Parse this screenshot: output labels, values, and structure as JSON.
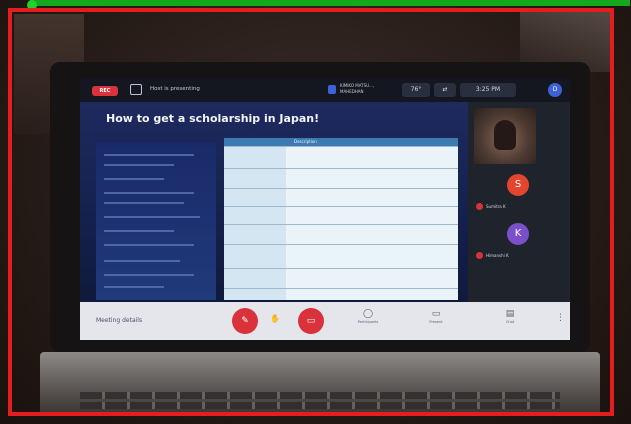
{
  "topbar": {
    "rec_label": "REC",
    "presenting_label": "Host is presenting",
    "host_name": "KIMIKO MATSU…, MAHEDHAN",
    "temp": "76°",
    "icon_btn": "⇄",
    "time": "3:25 PM",
    "avatar_letter": "D"
  },
  "slide": {
    "title": "How to get a scholarship in Japan!",
    "table_headers": [
      "",
      "Description"
    ]
  },
  "participants": [
    {
      "letter": "S",
      "color": "#e3452f",
      "name": "Sumitra K"
    },
    {
      "letter": "K",
      "color": "#7a4fc9",
      "name": "Himanshi K"
    }
  ],
  "controls": {
    "meeting_details": "Meeting details",
    "mute_icon": "✎",
    "hand_icon": "✋",
    "video_icon": "▭",
    "items": [
      {
        "icon": "◯",
        "label": "Participants"
      },
      {
        "icon": "▭",
        "label": "Present"
      },
      {
        "icon": "▤",
        "label": "Chat"
      }
    ],
    "more_icon": "⋮"
  },
  "colors": {
    "frame": "#e41e1e",
    "rec": "#d9323a",
    "accent": "#3d62d8"
  }
}
